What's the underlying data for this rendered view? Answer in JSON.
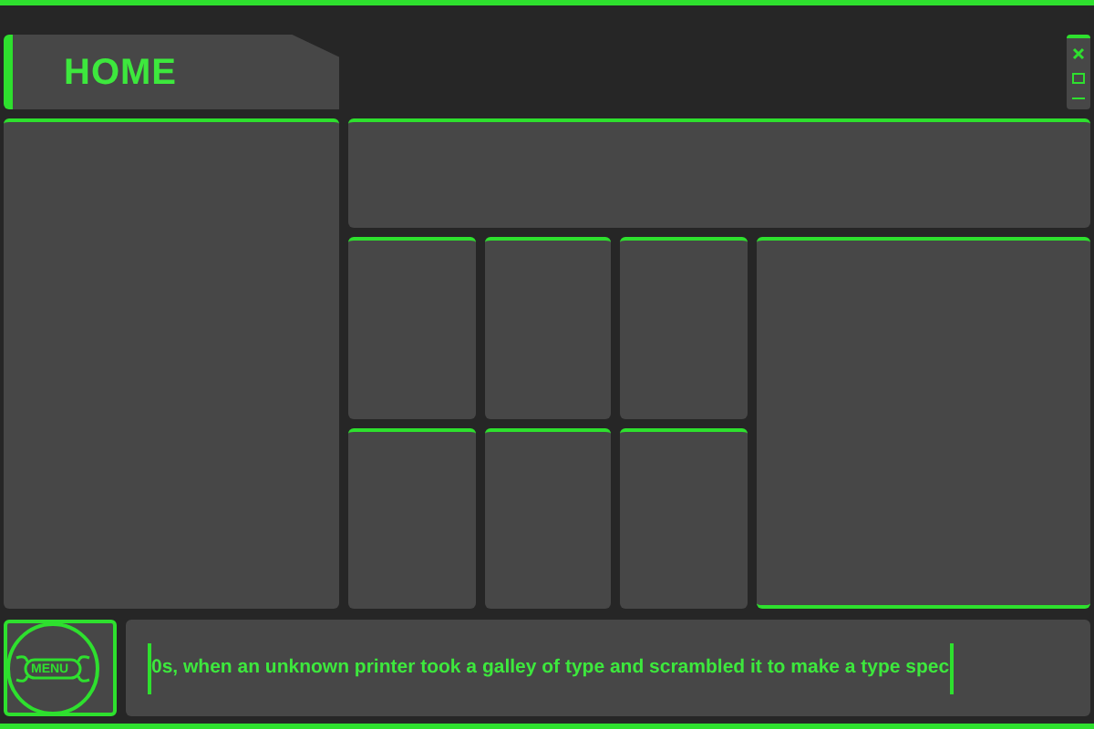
{
  "header": {
    "title": "HOME"
  },
  "menu_button": {
    "label": "MENU"
  },
  "ticker": {
    "text": "0s, when an unknown printer took a galley of type and scrambled it to make a type spec"
  }
}
